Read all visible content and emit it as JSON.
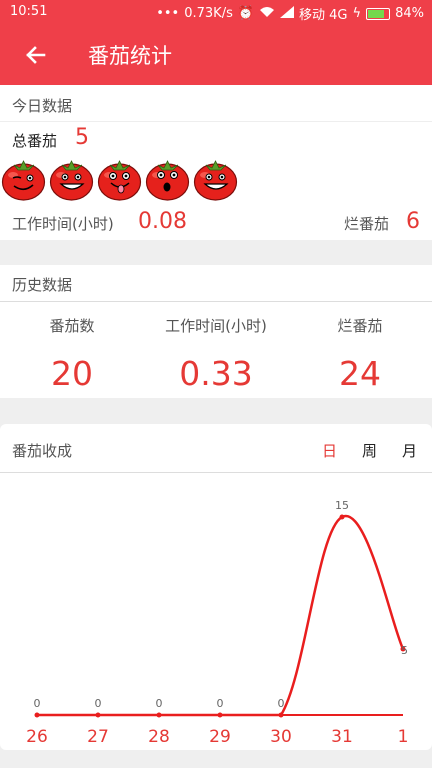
{
  "status_bar": {
    "time": "10:51",
    "net_speed": "0.73K/s",
    "carrier": "移动 4G",
    "battery": "84%",
    "battery_level": 0.84
  },
  "app_bar": {
    "title": "番茄统计",
    "back_icon": "arrow-left-icon"
  },
  "today": {
    "title": "今日数据",
    "total_label": "总番茄",
    "total_value": "5",
    "tomato_icons": [
      "tomato-wink-icon",
      "tomato-grin-icon",
      "tomato-tongue-icon",
      "tomato-surprised-icon",
      "tomato-grin-icon"
    ],
    "work_time_label": "工作时间(小时)",
    "work_time_value": "0.08",
    "rotten_label": "烂番茄",
    "rotten_value": "6"
  },
  "history": {
    "title": "历史数据",
    "columns": [
      {
        "label": "番茄数",
        "value": "20"
      },
      {
        "label": "工作时间(小时)",
        "value": "0.33"
      },
      {
        "label": "烂番茄",
        "value": "24"
      }
    ]
  },
  "harvest": {
    "title": "番茄收成",
    "tabs": [
      {
        "label": "日",
        "active": true
      },
      {
        "label": "周",
        "active": false
      },
      {
        "label": "月",
        "active": false
      }
    ]
  },
  "chart_data": {
    "type": "line",
    "x": [
      "26",
      "27",
      "28",
      "29",
      "30",
      "31",
      "1"
    ],
    "values": [
      0,
      0,
      0,
      0,
      0,
      15,
      5
    ],
    "data_labels": [
      "0",
      "0",
      "0",
      "0",
      "0",
      "15",
      "5"
    ],
    "ylim": [
      0,
      15
    ],
    "grid": false,
    "line_color": "#e91e1e",
    "tick_color": "#e53935"
  }
}
